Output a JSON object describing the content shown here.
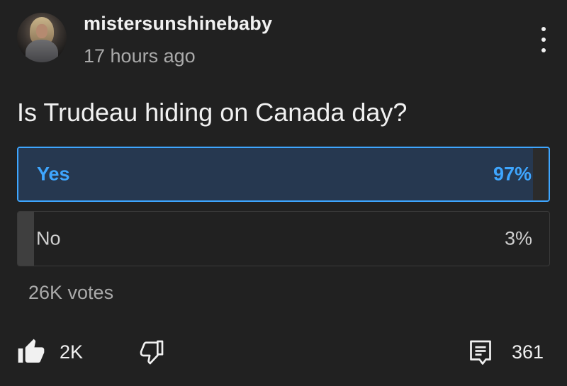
{
  "post": {
    "author": "mistersunshinebaby",
    "timestamp": "17 hours ago",
    "question": "Is Trudeau hiding on Canada day?"
  },
  "poll": {
    "options": [
      {
        "label": "Yes",
        "percent_text": "97%",
        "percent": 97,
        "selected": true
      },
      {
        "label": "No",
        "percent_text": "3%",
        "percent": 3,
        "selected": false
      }
    ],
    "votes": "26K votes"
  },
  "actions": {
    "likes": "2K",
    "comments": "361"
  },
  "colors": {
    "background": "#212121",
    "accent": "#3ea6ff",
    "selected_fill": "#263850"
  },
  "icons": [
    "avatar",
    "more-vert-icon",
    "thumbs-up-icon",
    "thumbs-down-icon",
    "comment-icon"
  ]
}
